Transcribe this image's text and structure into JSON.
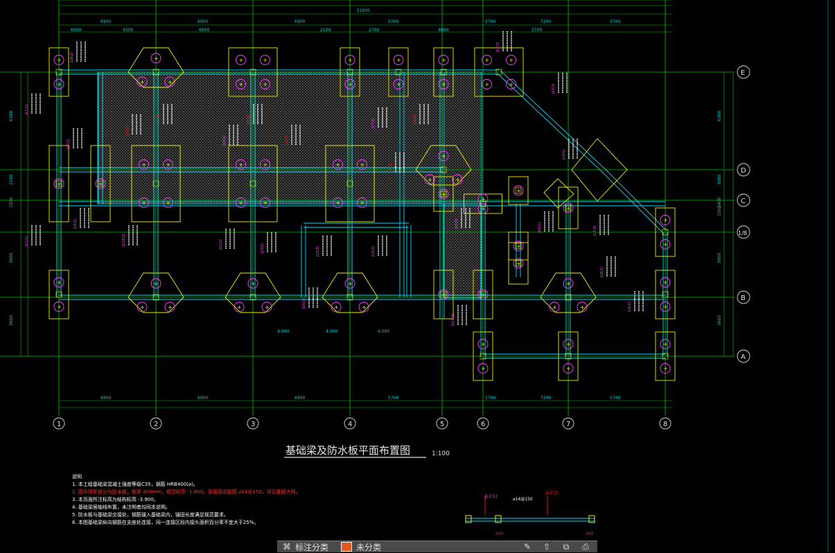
{
  "drawing": {
    "title": "基础梁及防水板平面布置图",
    "scale": "1:100",
    "axes_columns": [
      "1",
      "2",
      "3",
      "4",
      "5",
      "6",
      "7",
      "8"
    ],
    "axes_rows": [
      "E",
      "D",
      "C",
      "1/B",
      "B",
      "A"
    ],
    "dims_top_total": "51900",
    "dims_top": [
      "6900",
      "6900",
      "6900",
      "5700",
      "5700",
      "7200",
      "5700"
    ],
    "dims_mid_left": [
      "6000",
      "4500",
      "6900",
      "2100",
      "2700",
      "4800",
      "5700"
    ],
    "dims_bottom": [
      "6900",
      "6900",
      "6900",
      "5700",
      "5700",
      "7200",
      "5700"
    ],
    "dims_left": [
      "6300",
      "2100",
      "1500",
      "3900",
      "3600"
    ],
    "dims_right": [
      "6300",
      "3000",
      "2400",
      "1500",
      "3900",
      "3600"
    ],
    "beam_labels": [
      "JL1(1)",
      "JL2(2)",
      "JL3(3)",
      "JL4(1)",
      "JL5(2)",
      "JL6(1)",
      "JL7(3)",
      "JL8(2)",
      "JL9(1)",
      "JL10(2)"
    ],
    "bottom_dims_mid": [
      "4,000",
      "4,000",
      "4,000"
    ]
  },
  "notes": {
    "heading": "说明",
    "items": [
      "1. 本工程基础梁混凝土强度等级C35，钢筋 HRB400(⌀)。",
      "2. 图中阴影部分为防水板，板厚 400mm，板顶标高 -1.900，双层双向配筋 ⌀14@150，详见基础大样。",
      "3. 本页面所注标高为结构标高 -3.900。",
      "4. 基础梁居轴线布置，未注明者均同本说明。",
      "5. 防水板与基础梁交接处，钢筋锚入基础梁内，锚固长度满足规范要求。",
      "6. 本图基础梁纵向钢筋在支座处连接，同一连接区段内接头面积百分率不宜大于25%。"
    ]
  },
  "detail": {
    "labels": [
      "JL1(1)",
      "⌀14@150",
      "JL2(2)",
      "300",
      "300"
    ]
  },
  "toolbar": {
    "annotate_label": "标注分类",
    "layer_label": "未分类",
    "icons": [
      "edit-icon",
      "upload-icon",
      "copy-icon",
      "print-icon"
    ]
  },
  "colors": {
    "axis": "#00c800",
    "beam": "#00e0ff",
    "pile": "#f0f000",
    "text_magenta": "#ff40ff",
    "text_red": "#ff2020",
    "dim": "#00d0d0",
    "column": "#c8c800"
  }
}
